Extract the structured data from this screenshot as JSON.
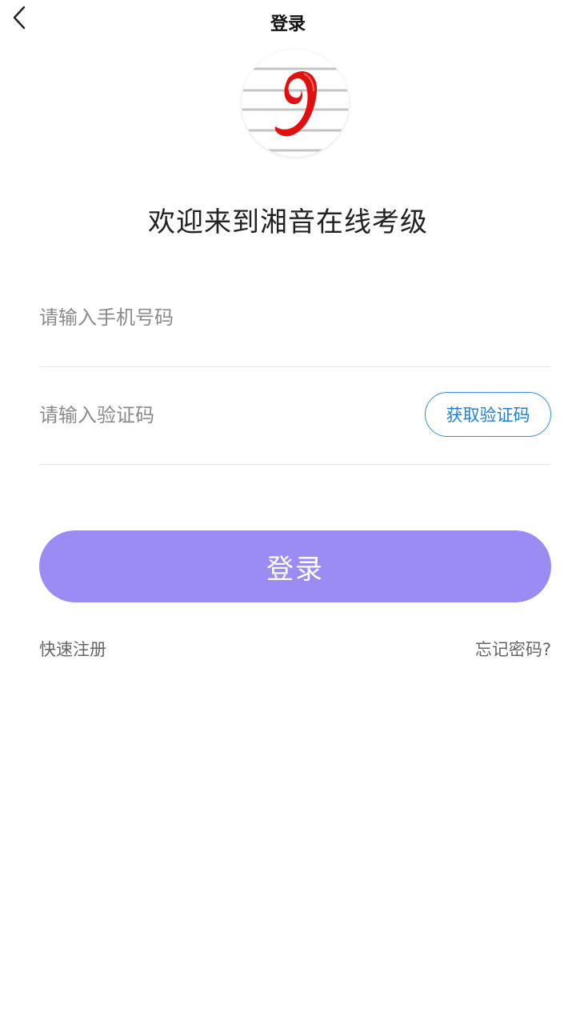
{
  "nav": {
    "title": "登录",
    "back_icon": "chevron-left-icon"
  },
  "logo": {
    "icon": "xiangyin-logo",
    "accent_color": "#e01010"
  },
  "welcome_text": "欢迎来到湘音在线考级",
  "form": {
    "phone": {
      "placeholder": "请输入手机号码",
      "value": ""
    },
    "code": {
      "placeholder": "请输入验证码",
      "value": ""
    },
    "get_code_label": "获取验证码"
  },
  "login_button_label": "登录",
  "links": {
    "register": "快速注册",
    "forgot": "忘记密码?"
  },
  "colors": {
    "primary": "#9b8cf4",
    "link_blue": "#2f8fea"
  }
}
